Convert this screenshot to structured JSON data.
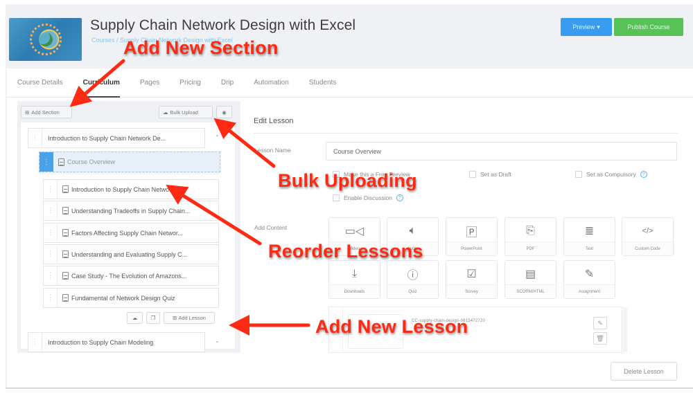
{
  "header": {
    "course_title": "Supply Chain Network Design with Excel",
    "breadcrumb": "Courses / Supply Chain Network Design with Excel",
    "preview_label": "Preview",
    "publish_label": "Publish Course"
  },
  "tabs": [
    {
      "label": "Course Details",
      "active": false
    },
    {
      "label": "Curriculum",
      "active": true
    },
    {
      "label": "Pages",
      "active": false
    },
    {
      "label": "Pricing",
      "active": false
    },
    {
      "label": "Drip",
      "active": false
    },
    {
      "label": "Automation",
      "active": false
    },
    {
      "label": "Students",
      "active": false
    }
  ],
  "curriculum": {
    "add_section_label": "Add Section",
    "bulk_upload_label": "Bulk Upload",
    "sections": [
      {
        "title": "Introduction to Supply Chain Network De...",
        "expanded": true,
        "lessons": [
          {
            "title": "Course Overview",
            "state": "dragging"
          },
          {
            "title": "Introduction to Supply Chain Network D..."
          },
          {
            "title": "Understanding Tradeoffs in Supply Chain..."
          },
          {
            "title": "Factors Affecting Supply Chain Networ..."
          },
          {
            "title": "Understanding and Evaluating Supply C..."
          },
          {
            "title": "Case Study - The Evolution of Amazons..."
          },
          {
            "title": "Fundamental of Network Design Quiz"
          }
        ]
      },
      {
        "title": "Introduction to Supply Chain Modeling",
        "expanded": false
      }
    ],
    "add_lesson_label": "Add Lesson"
  },
  "edit_lesson": {
    "heading": "Edit Lesson",
    "lesson_name_label": "Lesson Name",
    "lesson_name_value": "Course Overview",
    "options": [
      {
        "label": "Make this a Free Preview",
        "checked": false
      },
      {
        "label": "Set as Draft",
        "checked": false
      },
      {
        "label": "Set as Compulsory",
        "checked": false,
        "help": true
      },
      {
        "label": "Enable Discussion",
        "checked": false,
        "help": true
      }
    ],
    "add_content_label": "Add Content",
    "content_types": [
      {
        "label": "Video",
        "icon": "video-icon"
      },
      {
        "label": "Audio",
        "icon": "audio-icon"
      },
      {
        "label": "PowerPoint",
        "icon": "powerpoint-icon"
      },
      {
        "label": "PDF",
        "icon": "pdf-icon"
      },
      {
        "label": "Text",
        "icon": "text-icon"
      },
      {
        "label": "Custom Code",
        "icon": "code-icon"
      },
      {
        "label": "Downloads",
        "icon": "download-icon"
      },
      {
        "label": "Quiz",
        "icon": "quiz-icon"
      },
      {
        "label": "Survey",
        "icon": "survey-icon"
      },
      {
        "label": "SCORM/HTML",
        "icon": "scorm-icon"
      },
      {
        "label": "Assignment",
        "icon": "assignment-icon"
      }
    ],
    "media_file_name": "CC-supply-chain-design-0815472720",
    "delete_label": "Delete Lesson"
  },
  "annotations": {
    "add_section": "Add New Section",
    "bulk_uploading": "Bulk Uploading",
    "reorder_lessons": "Reorder Lessons",
    "add_lesson": "Add New Lesson"
  },
  "colors": {
    "preview_button": "#3a9cf0",
    "publish_button": "#58c258",
    "annotation": "#ff2a14",
    "drag_handle_active": "#4aa3ea"
  }
}
